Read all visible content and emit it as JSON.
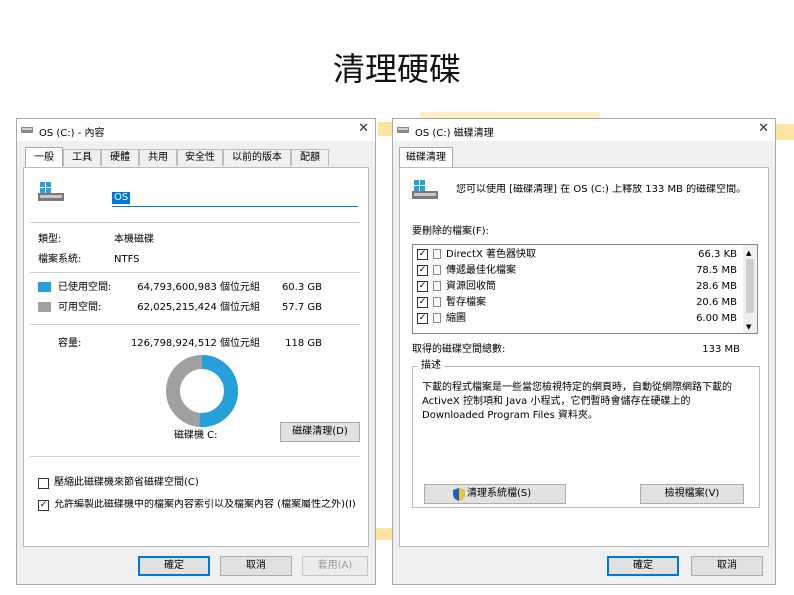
{
  "slide": {
    "title": "清理硬碟"
  },
  "colors": {
    "used": "#26a0da",
    "free": "#a0a0a0",
    "accent": "#0078d7"
  },
  "properties_window": {
    "title": "OS (C:) - 內容",
    "tabs": [
      "一般",
      "工具",
      "硬體",
      "共用",
      "安全性",
      "以前的版本",
      "配額"
    ],
    "name_value": "OS",
    "type_label": "類型:",
    "type_value": "本機磁碟",
    "fs_label": "檔案系統:",
    "fs_value": "NTFS",
    "used": {
      "label": "已使用空間:",
      "bytes": "64,793,600,983 個位元組",
      "size": "60.3 GB"
    },
    "free": {
      "label": "可用空間:",
      "bytes": "62,025,215,424 個位元組",
      "size": "57.7 GB"
    },
    "capacity": {
      "label": "容量:",
      "bytes": "126,798,924,512 個位元組",
      "size": "118 GB"
    },
    "used_fraction": 0.511,
    "drive_label": "磁碟機 C:",
    "cleanup_button": "磁碟清理(D)",
    "compress_option": "壓縮此磁碟機來節省磁碟空間(C)",
    "index_option": "允許編製此磁碟機中的檔案內容索引以及檔案內容 (檔案屬性之外)(I)",
    "compress_checked": false,
    "index_checked": true,
    "ok_button": "確定",
    "cancel_button": "取消",
    "apply_button": "套用(A)"
  },
  "cleanup_window": {
    "title": "OS (C:) 磁碟清理",
    "tab": "磁碟清理",
    "intro": "您可以使用 [磁碟清理] 在 OS (C:) 上釋放 133 MB 的磁碟空間。",
    "list_label": "要刪除的檔案(F):",
    "files": [
      {
        "name": "DirectX 著色器快取",
        "size": "66.3 KB",
        "checked": true
      },
      {
        "name": "傳遞最佳化檔案",
        "size": "78.5 MB",
        "checked": true
      },
      {
        "name": "資源回收筒",
        "size": "28.6 MB",
        "checked": true
      },
      {
        "name": "暫存檔案",
        "size": "20.6 MB",
        "checked": true
      },
      {
        "name": "縮圖",
        "size": "6.00 MB",
        "checked": true
      }
    ],
    "total_label": "取得的磁碟空間總數:",
    "total_value": "133 MB",
    "desc_label": "描述",
    "desc_lines": [
      "下載的程式檔案是一些當您檢視特定的網頁時，自動從網際網路下載的",
      "ActiveX 控制項和 Java 小程式，它們暫時會儲存在硬碟上的",
      "Downloaded Program Files 資料夾。"
    ],
    "clean_system_button": "清理系統檔(S)",
    "view_files_button": "檢視檔案(V)",
    "ok_button": "確定",
    "cancel_button": "取消"
  }
}
